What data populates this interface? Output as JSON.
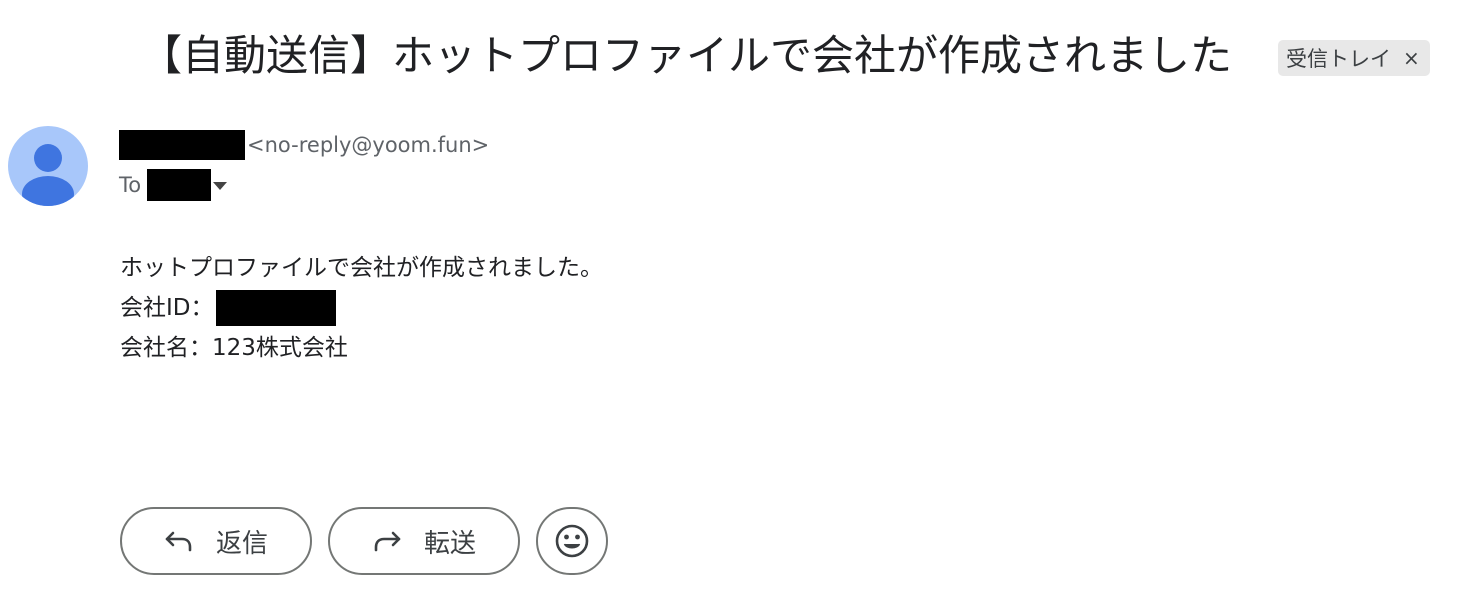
{
  "email": {
    "subject": "【自動送信】ホットプロファイルで会社が作成されました",
    "label": "受信トレイ",
    "label_close": "×",
    "sender_email": "<no-reply@yoom.fun>",
    "to_label": "To",
    "body": {
      "line1": "ホットプロファイルで会社が作成されました。",
      "company_id_label": "会社ID：",
      "company_name_line": "会社名：123株式会社"
    }
  },
  "actions": {
    "reply_label": "返信",
    "forward_label": "転送"
  },
  "icons": {
    "avatar": "person-icon",
    "reply": "reply-arrow-icon",
    "forward": "forward-arrow-icon",
    "emoji": "smiley-face-icon",
    "recipients": "caret-down-icon"
  },
  "colors": {
    "avatar_bg": "#a8c7fa",
    "avatar_figure": "#3f75e0",
    "chip_bg": "#e8e8e8",
    "redaction": "#000000"
  }
}
